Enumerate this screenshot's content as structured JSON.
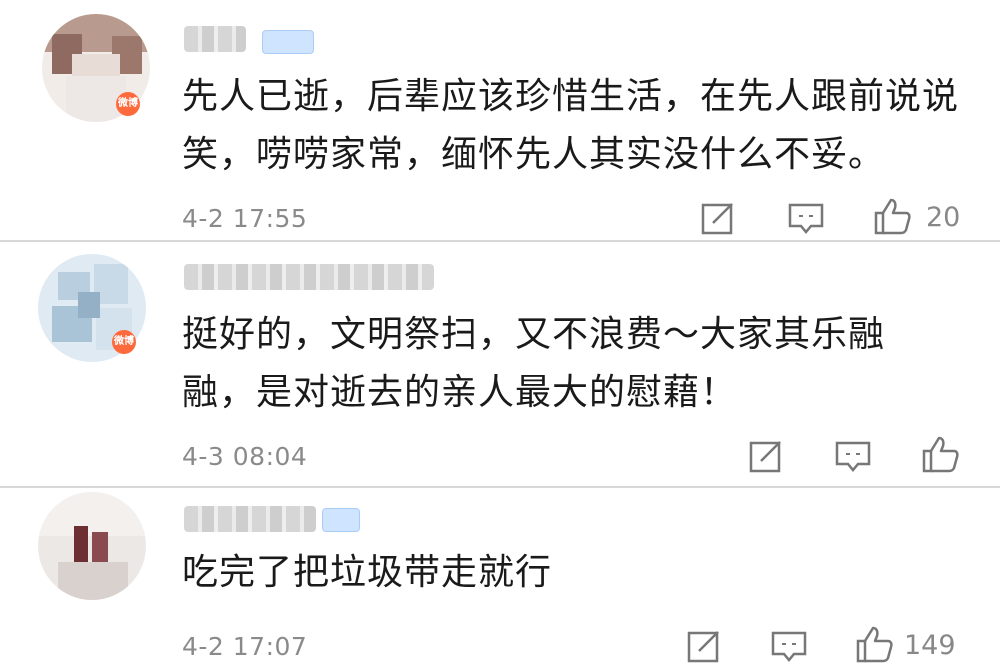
{
  "comments": [
    {
      "text": "先人已逝，后辈应该珍惜生活，在先人跟前说说笑，唠唠家常，缅怀先人其实没什么不妥。",
      "time": "4-2 17:55",
      "likes": "20",
      "avatar_badge": "微博"
    },
    {
      "text": "挺好的，文明祭扫，又不浪费～大家其乐融融，是对逝去的亲人最大的慰藉！",
      "time": "4-3 08:04",
      "likes": "",
      "avatar_badge": "微博"
    },
    {
      "text": "吃完了把垃圾带走就行",
      "time": "4-2 17:07",
      "likes": "149"
    }
  ],
  "icons": {
    "share": "share-icon",
    "reply": "comment-icon",
    "like": "thumbs-up-icon"
  },
  "colors": {
    "text": "#1a1a1a",
    "meta": "#8a8a8a",
    "divider": "#d8d8d8",
    "badge": "#ff6a3d"
  }
}
